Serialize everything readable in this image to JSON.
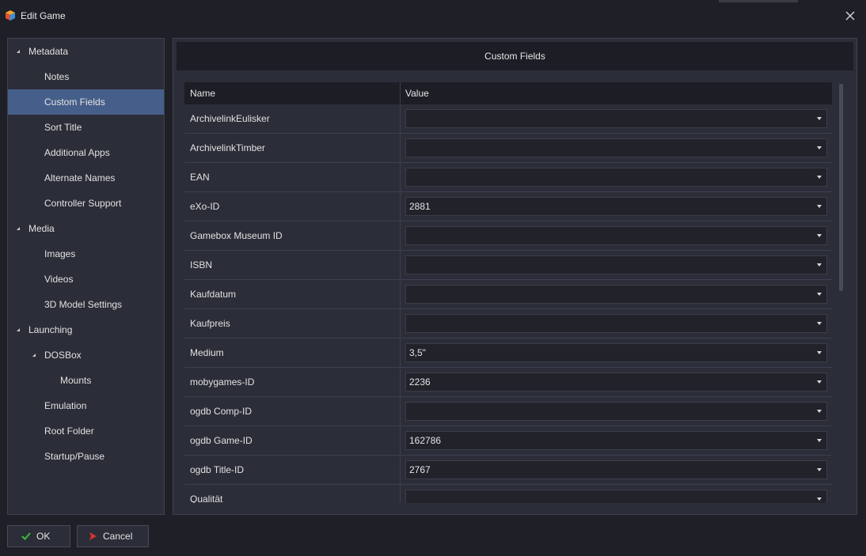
{
  "window": {
    "title": "Edit Game",
    "app_icon": "launchbox-cube-icon",
    "close_icon": "close-icon"
  },
  "sidebar": {
    "items": [
      {
        "label": "Metadata",
        "level": 0,
        "expandable": true
      },
      {
        "label": "Notes",
        "level": 1
      },
      {
        "label": "Custom Fields",
        "level": 1,
        "selected": true
      },
      {
        "label": "Sort Title",
        "level": 1
      },
      {
        "label": "Additional Apps",
        "level": 1
      },
      {
        "label": "Alternate Names",
        "level": 1
      },
      {
        "label": "Controller Support",
        "level": 1
      },
      {
        "label": "Media",
        "level": 0,
        "expandable": true
      },
      {
        "label": "Images",
        "level": 1
      },
      {
        "label": "Videos",
        "level": 1
      },
      {
        "label": "3D Model Settings",
        "level": 1
      },
      {
        "label": "Launching",
        "level": 0,
        "expandable": true
      },
      {
        "label": "DOSBox",
        "level": 1,
        "expandable": true
      },
      {
        "label": "Mounts",
        "level": 2
      },
      {
        "label": "Emulation",
        "level": 1
      },
      {
        "label": "Root Folder",
        "level": 1
      },
      {
        "label": "Startup/Pause",
        "level": 1
      }
    ]
  },
  "main": {
    "header": "Custom Fields",
    "columns": {
      "name": "Name",
      "value": "Value"
    },
    "rows": [
      {
        "name": "ArchivelinkEulisker",
        "value": ""
      },
      {
        "name": "ArchivelinkTimber",
        "value": ""
      },
      {
        "name": "EAN",
        "value": ""
      },
      {
        "name": "eXo-ID",
        "value": "2881"
      },
      {
        "name": "Gamebox Museum ID",
        "value": ""
      },
      {
        "name": "ISBN",
        "value": ""
      },
      {
        "name": "Kaufdatum",
        "value": ""
      },
      {
        "name": "Kaufpreis",
        "value": ""
      },
      {
        "name": "Medium",
        "value": "3,5\""
      },
      {
        "name": "mobygames-ID",
        "value": "2236"
      },
      {
        "name": "ogdb Comp-ID",
        "value": ""
      },
      {
        "name": "ogdb Game-ID",
        "value": "162786"
      },
      {
        "name": "ogdb Title-ID",
        "value": "2767"
      },
      {
        "name": "Qualität",
        "value": ""
      }
    ]
  },
  "footer": {
    "ok_label": "OK",
    "ok_icon": "checkmark-icon",
    "cancel_label": "Cancel",
    "cancel_icon": "cancel-icon"
  },
  "colors": {
    "background": "#1f2027",
    "panel": "#2b2d38",
    "selected": "#465f8a",
    "ok_check": "#3dbb3d",
    "cancel_red": "#d8322e"
  }
}
